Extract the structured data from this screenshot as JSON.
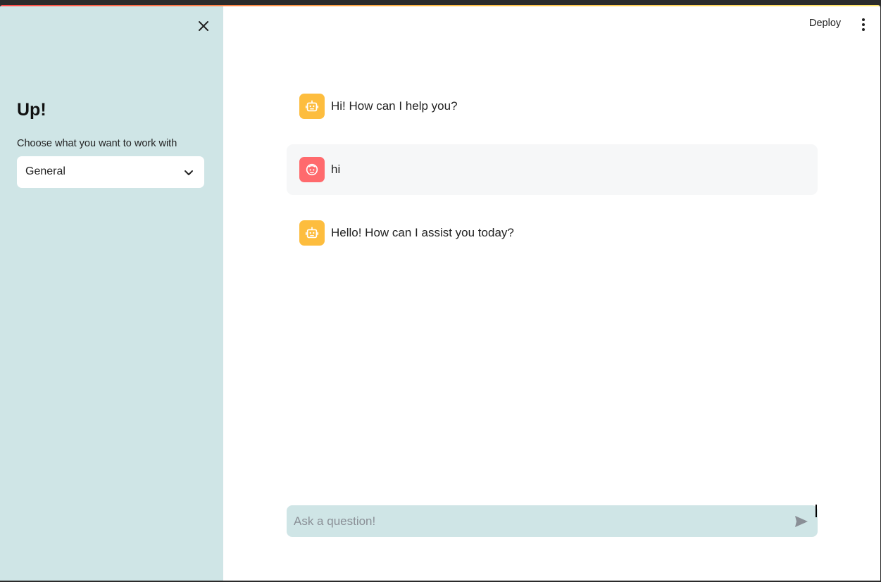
{
  "sidebar": {
    "title": "Up!",
    "select_label": "Choose what you want to work with",
    "select_value": "General",
    "close_icon": "close-icon",
    "chevron_icon": "chevron-down-icon",
    "background": "#cfe5e6"
  },
  "header": {
    "deploy_label": "Deploy",
    "menu_icon": "more-vertical-icon"
  },
  "messages": [
    {
      "role": "assistant",
      "text": "Hi! How can I help you?",
      "avatar_icon": "robot-icon",
      "avatar_color": "#fdbd3e"
    },
    {
      "role": "user",
      "text": "hi",
      "avatar_icon": "user-face-icon",
      "avatar_color": "#ff6a6d"
    },
    {
      "role": "assistant",
      "text": "Hello! How can I assist you today?",
      "avatar_icon": "robot-icon",
      "avatar_color": "#fdbd3e"
    }
  ],
  "chat_input": {
    "placeholder": "Ask a question!",
    "value": "",
    "send_icon": "send-icon"
  }
}
